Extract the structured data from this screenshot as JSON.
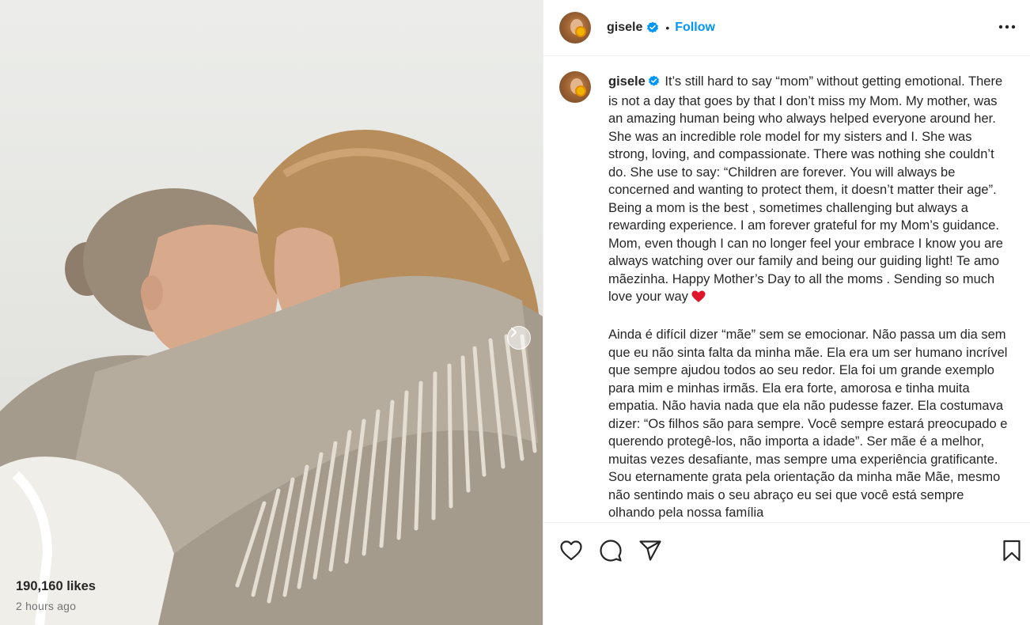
{
  "post": {
    "username": "gisele",
    "verified": true,
    "follow_label": "Follow",
    "separator": "•",
    "caption_english": "It’s still hard to say “mom” without getting emotional. There is not a day that goes by that I don’t miss my Mom. My mother, was an amazing human being who always helped everyone around her. She was an incredible role model for my sisters and I. She was strong, loving, and compassionate. There was nothing she couldn’t do. She use to say: “Children are forever. You will always be concerned and wanting to protect them, it doesn’t matter their age”. Being a mom is the best , sometimes challenging but always a rewarding experience. I am forever grateful for my Mom’s guidance. Mom, even though I can no longer feel your embrace I know you are always watching over our family and being our guiding light! Te amo mãezinha. Happy Mother’s Day to all the moms . Sending so much love your way",
    "caption_portuguese": "Ainda é difícil dizer “mãe” sem se emocionar. Não passa um dia sem que eu não sinta falta da minha mãe. Ela era um ser humano incrível que sempre ajudou todos ao seu redor. Ela foi um grande exemplo para mim e minhas irmãs. Ela era forte, amorosa e tinha muita empatia. Não havia nada que ela não pudesse fazer. Ela costumava dizer: “Os filhos são para sempre. Você sempre estará preocupado e querendo protegê-los, não importa a idade”. Ser mãe é a melhor, muitas vezes desafiante, mas sempre uma experiência gratificante. Sou eternamente grata pela orientação da minha mãe Mãe, mesmo não sentindo mais o seu abraço eu sei que você está sempre olhando pela nossa família",
    "likes": "190,160 likes",
    "timestamp": "2 hours ago"
  },
  "icons": {
    "verified": "verified-badge-icon",
    "more": "more-options-icon",
    "like": "heart-outline-icon",
    "comment": "comment-bubble-icon",
    "share": "paper-plane-icon",
    "save": "bookmark-icon",
    "next": "chevron-right-icon",
    "emoji": "red-heart-emoji"
  },
  "colors": {
    "accent": "#0095f6",
    "text": "#262626",
    "secondary_text": "#737373",
    "border": "#efefef",
    "heart_emoji": "#e0142c"
  }
}
